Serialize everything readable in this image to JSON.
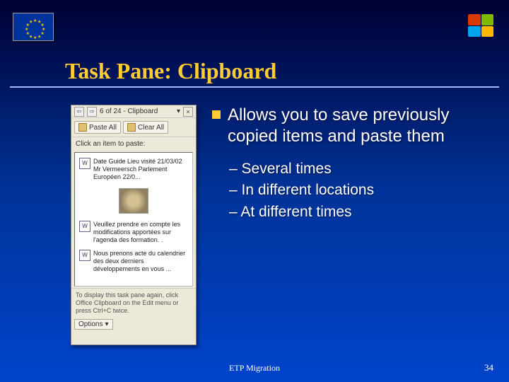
{
  "slide": {
    "title": "Task Pane: Clipboard",
    "footer": "ETP Migration",
    "page_number": "34"
  },
  "content": {
    "main_point": "Allows you to save previously copied items and paste them",
    "sub_points": [
      "– Several times",
      "– In different locations",
      "– At different times"
    ]
  },
  "taskpane": {
    "header_title": "6 of 24 - Clipboard",
    "paste_all_label": "Paste All",
    "clear_all_label": "Clear All",
    "click_hint": "Click an item to paste:",
    "items": [
      {
        "type": "text",
        "text": "Date Guide Lieu visité 21/03/02 Mr Vermeersch Parlement Européen 22/0..."
      },
      {
        "type": "image"
      },
      {
        "type": "text",
        "text": "Veuillez prendre en compte les modifications apportées sur l'agenda des formation. ."
      },
      {
        "type": "text",
        "text": "Nous prenons acte du calendrier des deux derniers développements en vous ..."
      }
    ],
    "tip": "To display this task pane again, click Office Clipboard on the Edit menu or press Ctrl+C twice.",
    "options_label": "Options"
  },
  "icons": {
    "word_glyph": "W",
    "dropdown_glyph": "▾",
    "close_glyph": "×",
    "back_glyph": "⇦",
    "fwd_glyph": "⇨"
  }
}
